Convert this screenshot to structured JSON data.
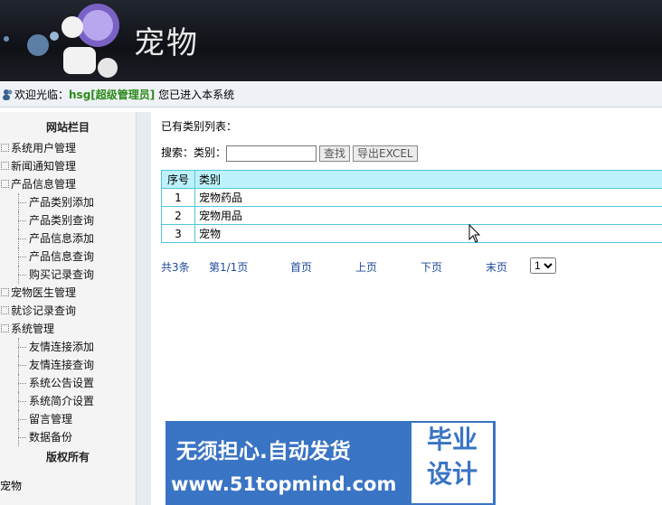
{
  "header": {
    "title": "宠物"
  },
  "welcome": {
    "prefix": "欢迎光临：",
    "user": "hsg[超级管理员]",
    "suffix": " 您已进入本系统"
  },
  "sidebar": {
    "heading": "网站栏目",
    "items": [
      {
        "label": "系统用户管理",
        "level": 1
      },
      {
        "label": "新闻通知管理",
        "level": 1
      },
      {
        "label": "产品信息管理",
        "level": 1
      },
      {
        "label": "产品类别添加",
        "level": 2
      },
      {
        "label": "产品类别查询",
        "level": 2
      },
      {
        "label": "产品信息添加",
        "level": 2
      },
      {
        "label": "产品信息查询",
        "level": 2
      },
      {
        "label": "购买记录查询",
        "level": 2
      },
      {
        "label": "宠物医生管理",
        "level": 1
      },
      {
        "label": "就诊记录查询",
        "level": 1
      },
      {
        "label": "系统管理",
        "level": 1
      },
      {
        "label": "友情连接添加",
        "level": 2
      },
      {
        "label": "友情连接查询",
        "level": 2
      },
      {
        "label": "系统公告设置",
        "level": 2
      },
      {
        "label": "系统简介设置",
        "level": 2
      },
      {
        "label": "留言管理",
        "level": 2
      },
      {
        "label": "数据备份",
        "level": 2
      }
    ],
    "copyright": "版权所有",
    "site": "宠物"
  },
  "main": {
    "list_title": "已有类别列表：",
    "search": {
      "label": "搜索：类别：",
      "value": "",
      "search_button": "查找",
      "export_button": "导出EXCEL"
    },
    "table": {
      "headers": [
        "序号",
        "类别"
      ],
      "rows": [
        {
          "no": "1",
          "name": "宠物药品"
        },
        {
          "no": "2",
          "name": "宠物用品"
        },
        {
          "no": "3",
          "name": "宠物"
        }
      ]
    },
    "pager": {
      "total": "共3条",
      "page": "第1/1页",
      "first": "首页",
      "prev": "上页",
      "next": "下页",
      "last": "末页",
      "selected": "1"
    }
  },
  "banner": {
    "line1": "无须担心.自动发货",
    "line2": "www.51topmind.com",
    "box1": "毕业",
    "box2": "设计"
  },
  "colors": {
    "table_border": "#4fc7dd",
    "table_header": "#bdf1fb",
    "link": "#1f4a9a",
    "username": "#2c8a18",
    "banner": "#3a74c4"
  }
}
